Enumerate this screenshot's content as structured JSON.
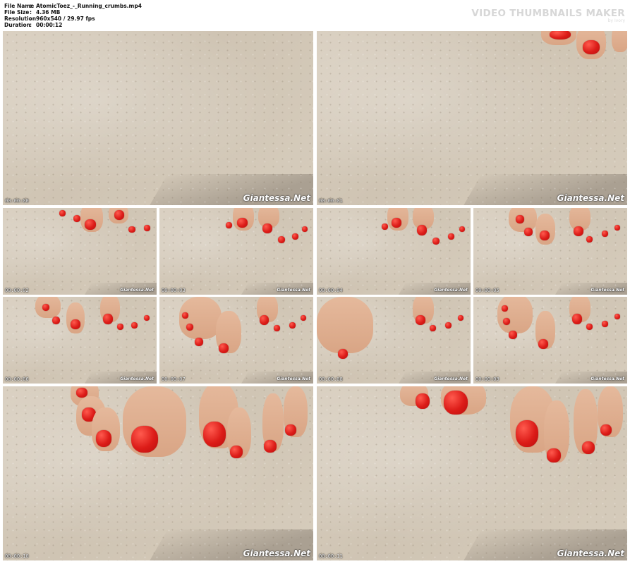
{
  "file_info": {
    "rows": [
      {
        "label": "File Name",
        "sep": ":",
        "value": "AtomicToez_-_Running_crumbs.mp4"
      },
      {
        "label": "File Size",
        "sep": ":",
        "value": "4.36 MB"
      },
      {
        "label": "Resolution",
        "sep": ":",
        "value": "960x540 / 29.97 fps"
      },
      {
        "label": "Duration",
        "sep": ":",
        "value": "00:00:12"
      }
    ]
  },
  "branding": {
    "title": "VIDEO THUMBNAILS MAKER",
    "subtitle": "by Ivory"
  },
  "watermark": "Giantessa.Net",
  "thumbnails": [
    {
      "timestamp": "00:00:00"
    },
    {
      "timestamp": "00:00:01"
    },
    {
      "timestamp": "00:00:02"
    },
    {
      "timestamp": "00:00:03"
    },
    {
      "timestamp": "00:00:04"
    },
    {
      "timestamp": "00:00:05"
    },
    {
      "timestamp": "00:00:06"
    },
    {
      "timestamp": "00:00:07"
    },
    {
      "timestamp": "00:00:08"
    },
    {
      "timestamp": "00:00:09"
    },
    {
      "timestamp": "00:00:10"
    },
    {
      "timestamp": "00:00:11"
    }
  ],
  "colors": {
    "background": "#ffffff",
    "concrete": "#d4c9b8",
    "nail_polish": "#dc1c18",
    "skin": "#e0b090"
  }
}
